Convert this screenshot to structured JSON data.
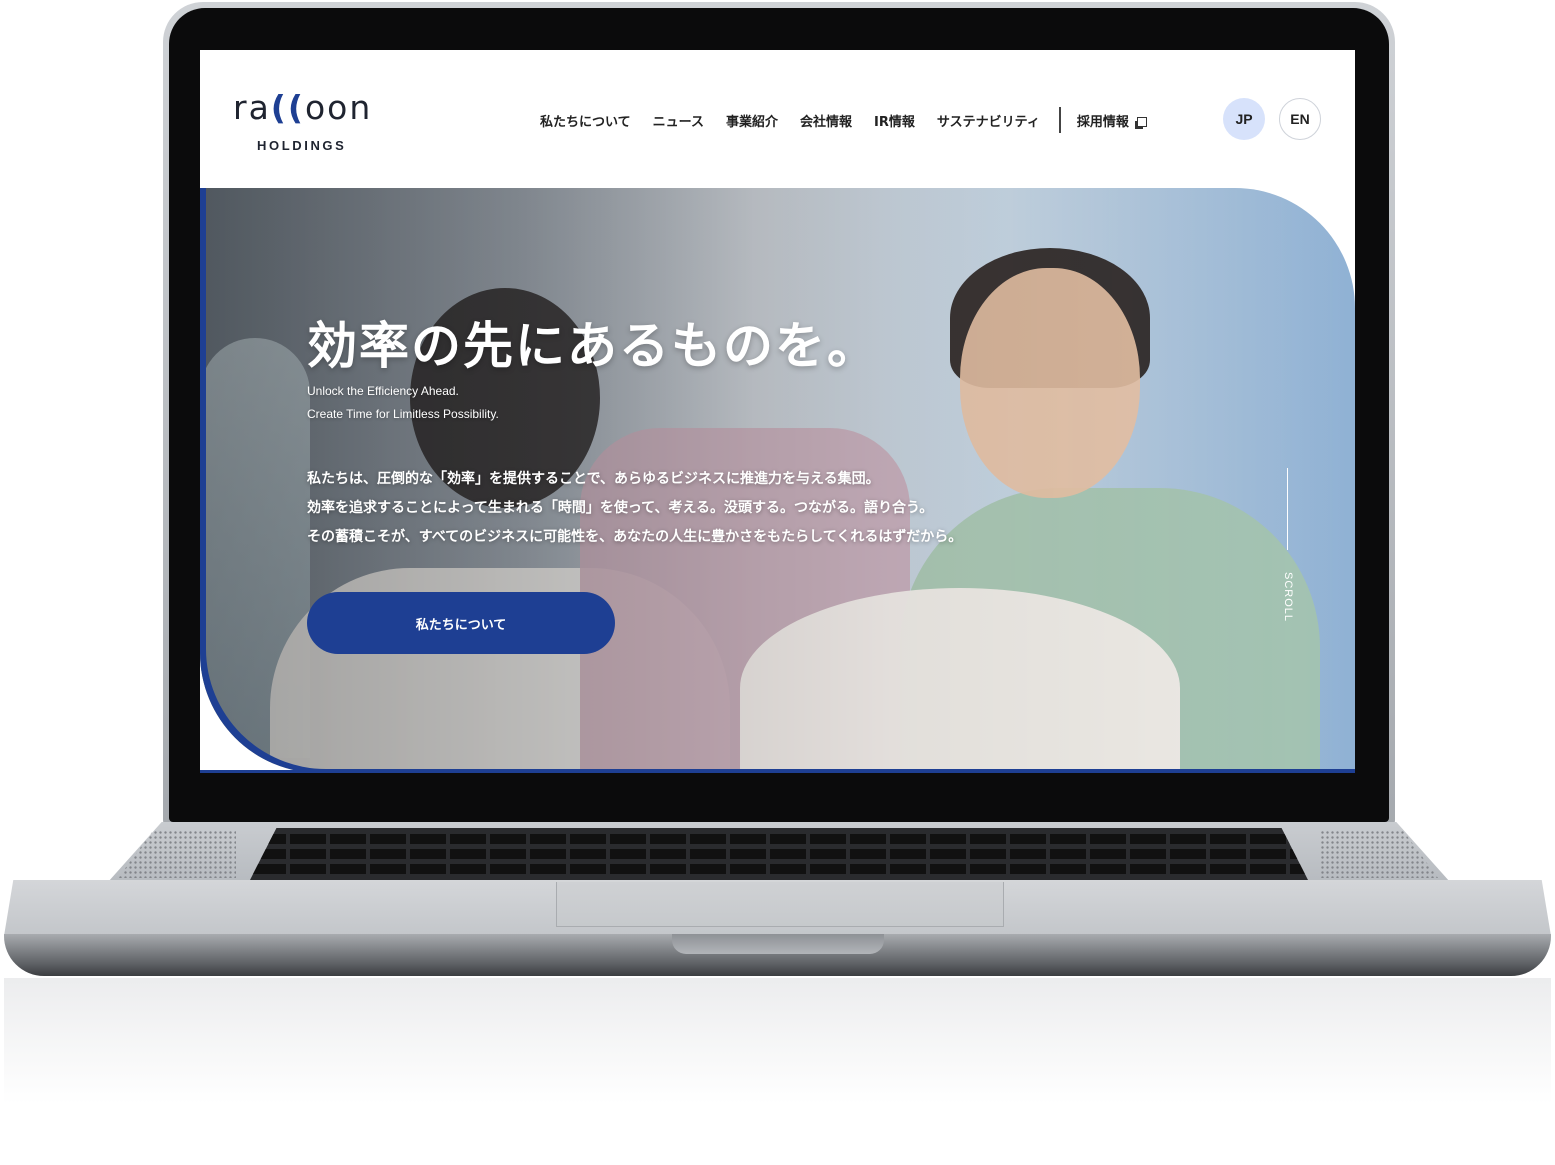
{
  "brand": {
    "logo_pre": "ra",
    "logo_paren": "((",
    "logo_post": "oon",
    "logo_sub": "HOLDINGS"
  },
  "nav": {
    "items": [
      {
        "label": "私たちについて"
      },
      {
        "label": "ニュース"
      },
      {
        "label": "事業紹介"
      },
      {
        "label": "会社情報"
      },
      {
        "label": "IR情報"
      },
      {
        "label": "サステナビリティ"
      }
    ],
    "recruit_label": "採用情報",
    "lang_jp": "JP",
    "lang_en": "EN"
  },
  "hero": {
    "headline": "効率の先にあるものを。",
    "sub_en_1": "Unlock the Efficiency Ahead.",
    "sub_en_2": "Create Time for Limitless Possibility.",
    "body_1": "私たちは、圧倒的な「効率」を提供することで、あらゆるビジネスに推進力を与える集団。",
    "body_2": "効率を追求することによって生まれる「時間」を使って、考える。没頭する。つながる。語り合う。",
    "body_3": "その蓄積こそが、すべてのビジネスに可能性を、あなたの人生に豊かさをもたらしてくれるはずだから。",
    "cta_label": "私たちについて",
    "scroll_label": "SCROLL"
  },
  "colors": {
    "brand_blue": "#1e3f93",
    "jp_active_bg": "#d7e2fb"
  },
  "icons": {
    "external_link": "external-link-icon"
  }
}
